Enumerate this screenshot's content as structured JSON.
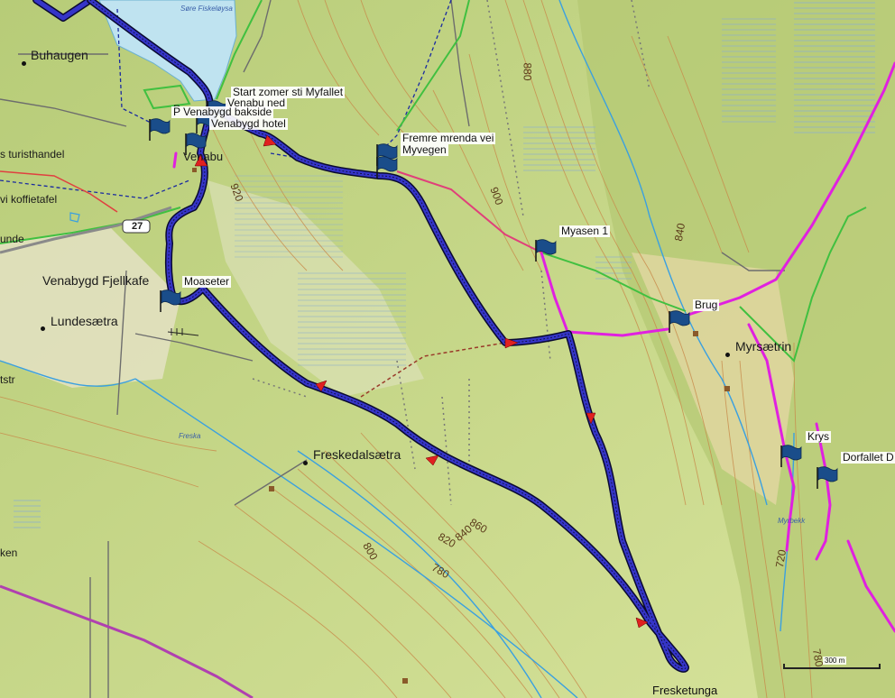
{
  "map": {
    "place_labels": [
      {
        "id": "buhaugen",
        "text": "Buhaugen"
      },
      {
        "id": "turisthandel",
        "text": "s turisthandel"
      },
      {
        "id": "koffietafel",
        "text": "vi koffietafel"
      },
      {
        "id": "unde",
        "text": "unde"
      },
      {
        "id": "venabygd-fjellkafe",
        "text": "Venabygd Fjellkafe"
      },
      {
        "id": "lundesaetra",
        "text": "Lundesætra"
      },
      {
        "id": "tstr",
        "text": "tstr"
      },
      {
        "id": "freskedalsaetra",
        "text": "Freskedalsætra"
      },
      {
        "id": "ken",
        "text": "ken"
      },
      {
        "id": "venabu",
        "text": "Venabu"
      },
      {
        "id": "myrsaetrin",
        "text": "Myrsætrin"
      },
      {
        "id": "fresketunga",
        "text": "Fresketunga"
      }
    ],
    "water_labels": [
      {
        "id": "sore-fiskeloysa",
        "text": "Søre Fiskeløysa"
      },
      {
        "id": "freska",
        "text": "Freska"
      },
      {
        "id": "myrbekk",
        "text": "Myrbekk"
      }
    ],
    "contour_labels": [
      "880",
      "900",
      "920",
      "840",
      "860",
      "840",
      "820",
      "800",
      "780",
      "720",
      "780"
    ],
    "road_shield": "27",
    "parking_letter": "P",
    "waypoints": [
      {
        "id": "start-zomer-sti",
        "text": "Start zomer sti Myfallet"
      },
      {
        "id": "venabu-ned",
        "text": "Venabu ned"
      },
      {
        "id": "venabygd-bakside",
        "text": "P  Venabygd bakside"
      },
      {
        "id": "venabygd-hotel",
        "text": "Venabygd hotel"
      },
      {
        "id": "fremre-mrenda",
        "text": "Fremre mrenda vei"
      },
      {
        "id": "myvegen",
        "text": "Myvegen"
      },
      {
        "id": "myasen",
        "text": "Myasen 1"
      },
      {
        "id": "brug",
        "text": "Brug"
      },
      {
        "id": "moaseter",
        "text": "Moaseter"
      },
      {
        "id": "krys",
        "text": "Krys"
      },
      {
        "id": "dorfallet",
        "text": "Dorfallet D"
      }
    ],
    "scale_label": "300 m",
    "colors": {
      "terrain": "#c9d98a",
      "terrain_dark": "#9fb765",
      "water": "#bfe3f0",
      "route": "#2a2ab8",
      "route_outline": "#0a0a30",
      "trail_pink": "#e020e0",
      "trail_green": "#40c040",
      "contour": "#c88a4a",
      "stream": "#3aa0e0",
      "arrow": "#e02020",
      "flag": "#1a4d8a"
    }
  }
}
